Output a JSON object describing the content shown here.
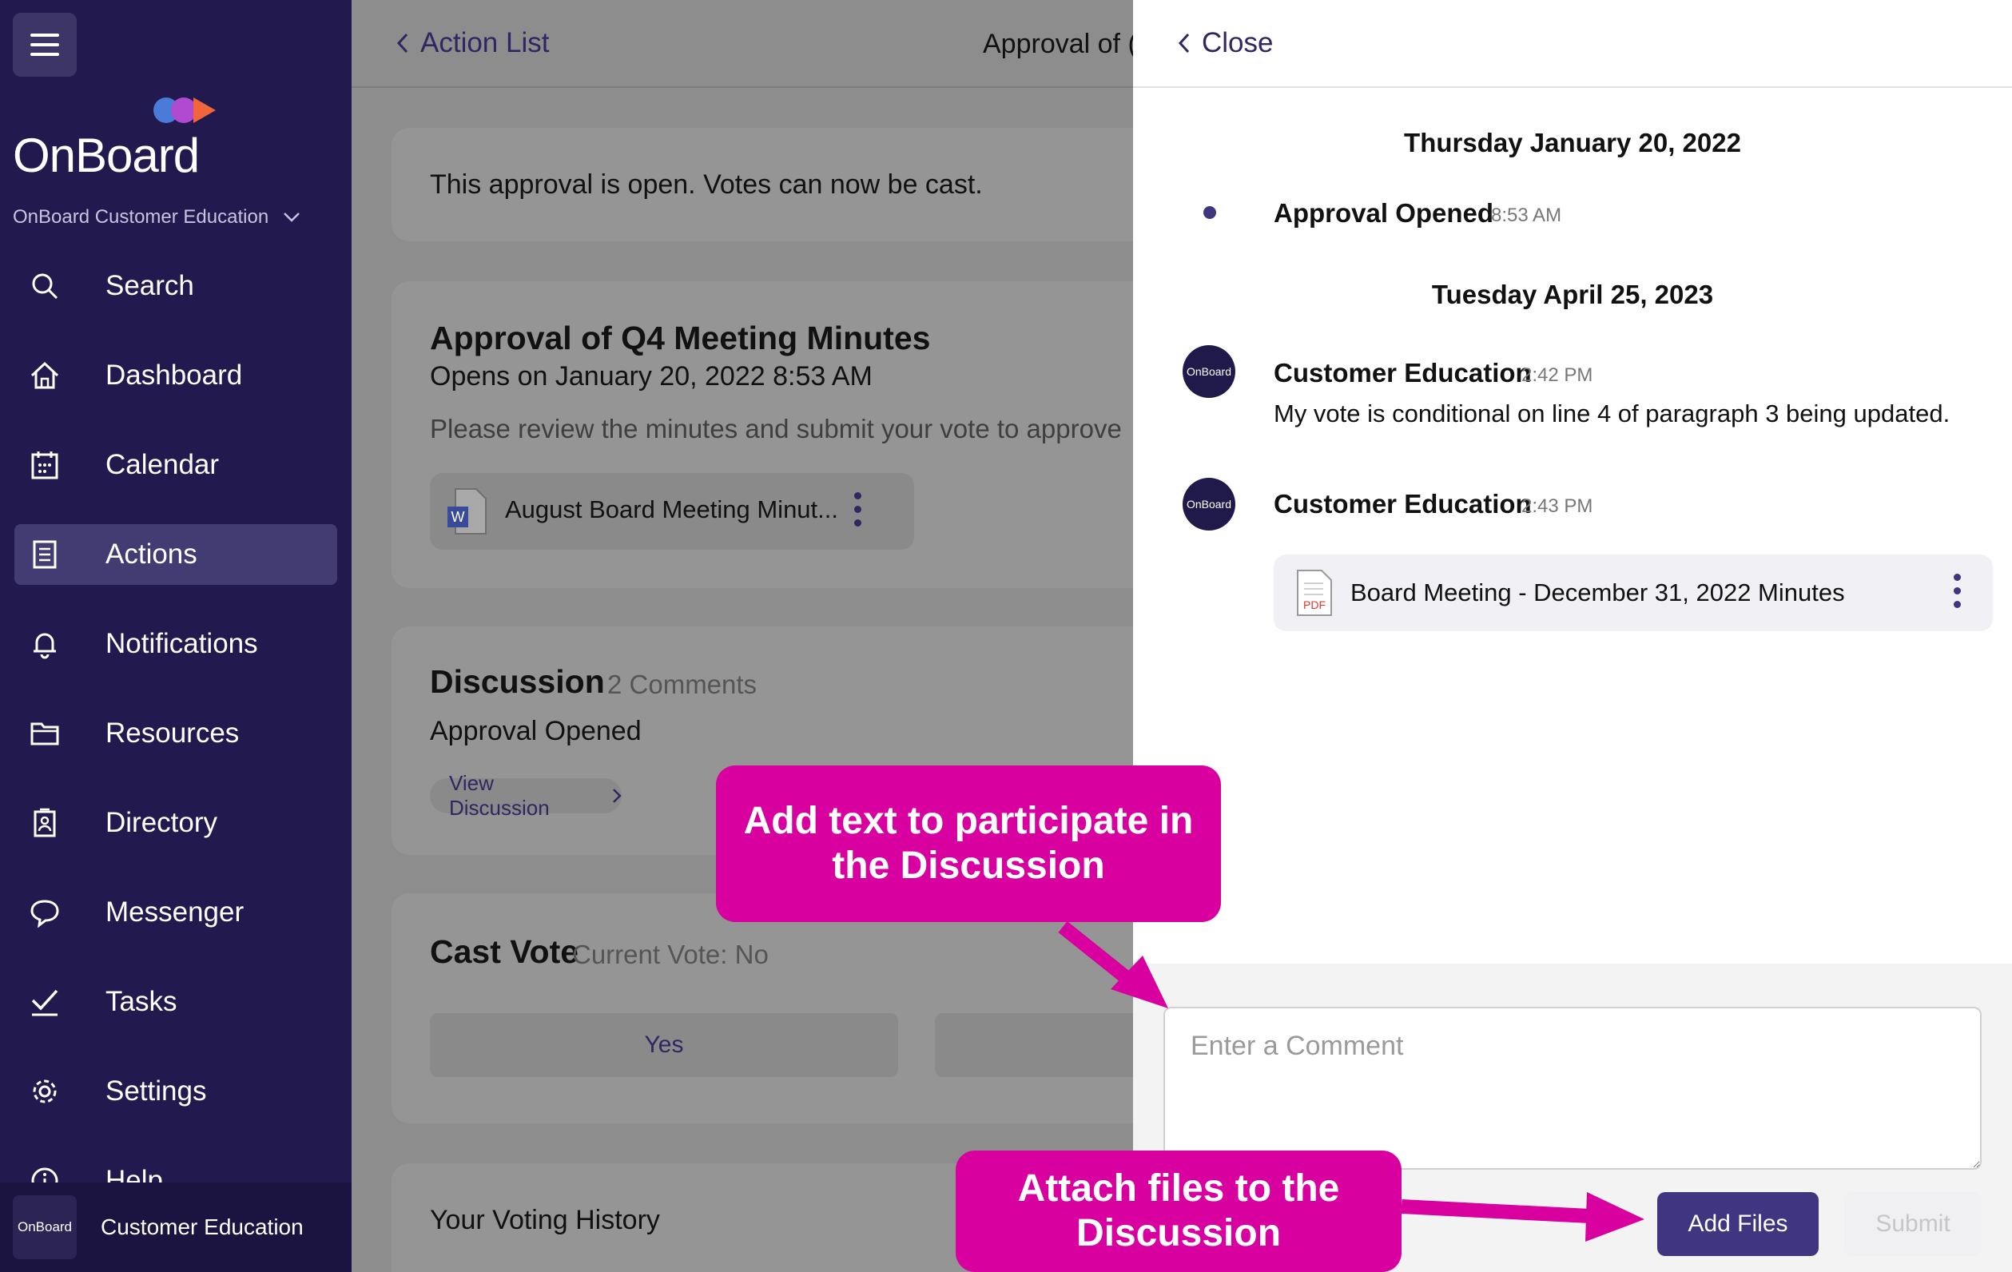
{
  "sidebar": {
    "org_name": "OnBoard Customer Education",
    "logo_text": "OnBoard",
    "items": [
      {
        "label": "Search",
        "icon": "search-icon"
      },
      {
        "label": "Dashboard",
        "icon": "home-icon"
      },
      {
        "label": "Calendar",
        "icon": "calendar-icon"
      },
      {
        "label": "Actions",
        "icon": "actions-list-icon",
        "active": true
      },
      {
        "label": "Notifications",
        "icon": "bell-icon"
      },
      {
        "label": "Resources",
        "icon": "folder-icon"
      },
      {
        "label": "Directory",
        "icon": "directory-icon"
      },
      {
        "label": "Messenger",
        "icon": "chat-bubble-icon"
      },
      {
        "label": "Tasks",
        "icon": "checkmark-icon"
      },
      {
        "label": "Settings",
        "icon": "gear-icon"
      },
      {
        "label": "Help",
        "icon": "info-icon"
      }
    ],
    "user": {
      "avatar_text": "OnBoard",
      "name": "Customer Education"
    }
  },
  "main": {
    "back_label": "Action List",
    "title": "Approval of (",
    "status_text": "This approval is open. Votes can now be cast.",
    "approval": {
      "title": "Approval of Q4 Meeting Minutes",
      "opens": "Opens on January 20, 2022 8:53 AM",
      "description": "Please review the minutes and submit your vote to approve",
      "file_name": "August Board Meeting Minut...",
      "file_icon_letter": "W"
    },
    "discussion": {
      "heading": "Discussion",
      "count": "2 Comments",
      "latest": "Approval Opened",
      "view_label": "View Discussion"
    },
    "vote": {
      "heading": "Cast Vote",
      "current": "Current Vote: No",
      "yes_label": "Yes"
    },
    "history_heading": "Your Voting History"
  },
  "panel": {
    "close_label": "Close",
    "dates": [
      "Thursday January 20, 2022",
      "Tuesday April 25, 2023"
    ],
    "event": {
      "label": "Approval Opened",
      "time": "8:53 AM"
    },
    "comments": [
      {
        "author": "Customer Education",
        "time": "2:42 PM",
        "text": "My vote is conditional on line 4 of paragraph 3 being updated.",
        "avatar_text": "OnBoard"
      },
      {
        "author": "Customer Education",
        "time": "2:43 PM",
        "attachment": "Board Meeting - December 31, 2022 Minutes",
        "attachment_icon": "PDF",
        "avatar_text": "OnBoard"
      }
    ],
    "comment_placeholder": "Enter a Comment",
    "add_files_label": "Add Files",
    "submit_label": "Submit"
  },
  "callouts": {
    "participate": "Add text to participate in the Discussion",
    "attach": "Attach files to the Discussion"
  },
  "colors": {
    "sidebar_bg": "#221a4e",
    "accent": "#3f3580",
    "callout": "#d8009e",
    "overlay_gray": "#8d8d8d"
  }
}
